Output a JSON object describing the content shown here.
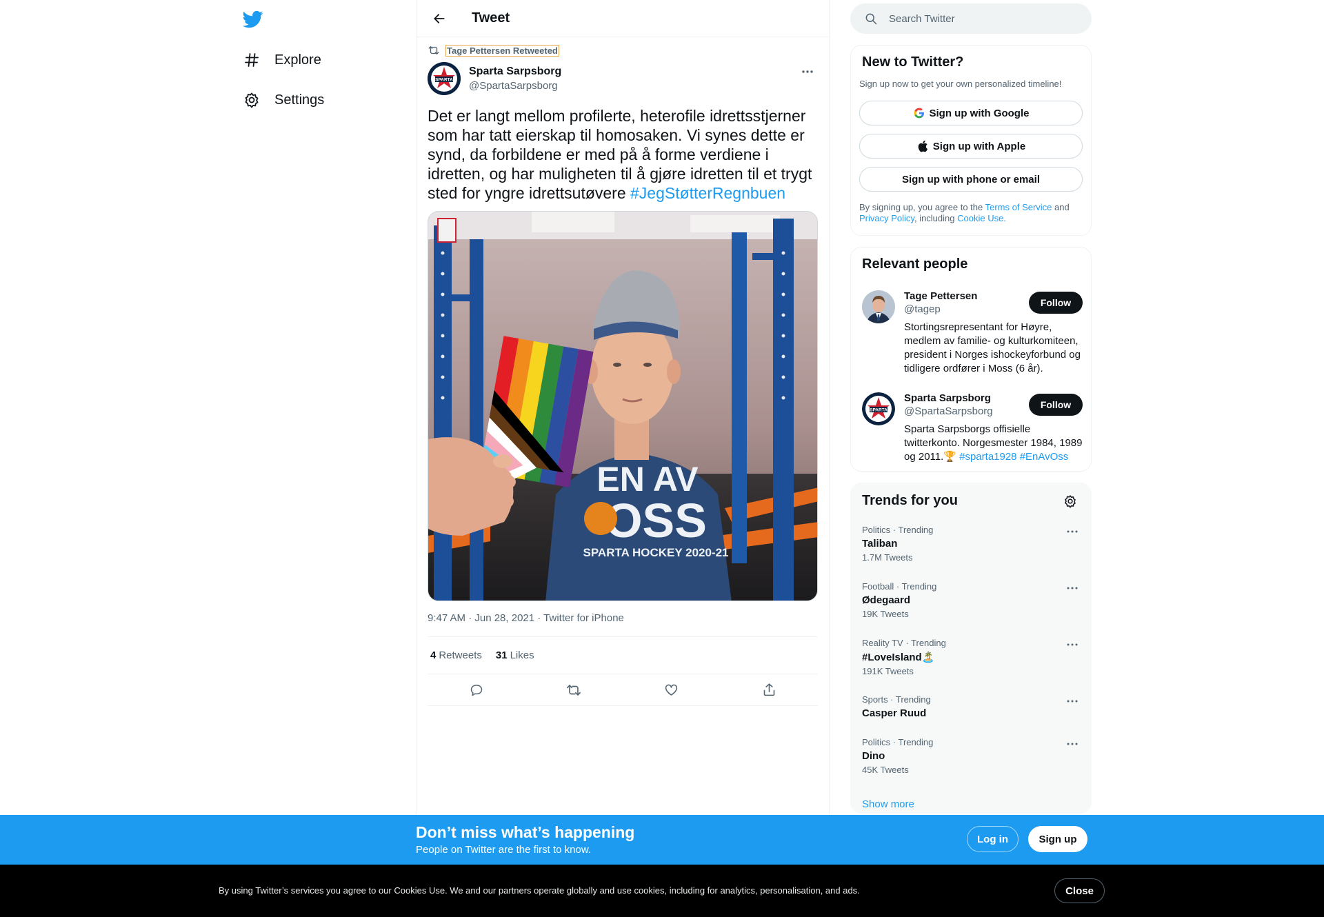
{
  "nav": {
    "logo_icon": "twitter-bird-icon",
    "items": [
      {
        "label": "Explore",
        "icon": "hashtag-icon"
      },
      {
        "label": "Settings",
        "icon": "gear-icon"
      }
    ]
  },
  "header": {
    "title": "Tweet"
  },
  "tweet": {
    "retweeted_by": "Tage Pettersen Retweeted",
    "author_name": "Sparta Sarpsborg",
    "author_handle": "@SpartaSarpsborg",
    "text": "Det er langt mellom profilerte, heterofile idrettsstjerner som har tatt eierskap til homosaken. Vi synes dette er synd, da forbildene er med på å forme verdiene i idretten, og har muligheten til å gjøre idretten til et trygt sted for yngre idrettsutøvere ",
    "hashtag": "#JegStøtterRegnbuen",
    "shirt_line1": "EN AV",
    "shirt_line2": "OSS",
    "shirt_line3": "SPARTA HOCKEY 2020-21",
    "meta": "9:47 AM · Jun 28, 2021 · Twitter for iPhone",
    "retweets_count": "4",
    "retweets_label": "Retweets",
    "likes_count": "31",
    "likes_label": "Likes"
  },
  "search": {
    "placeholder": "Search Twitter"
  },
  "signup": {
    "title": "New to Twitter?",
    "subtitle": "Sign up now to get your own personalized timeline!",
    "google": "Sign up with Google",
    "apple": "Sign up with Apple",
    "phone_email": "Sign up with phone or email",
    "legal_prefix": "By signing up, you agree to the ",
    "terms": "Terms of Service",
    "and": " and ",
    "privacy": "Privacy Policy",
    "including": ", including ",
    "cookie_use": "Cookie Use."
  },
  "relevant_people": {
    "title": "Relevant people",
    "follow_label": "Follow",
    "people": [
      {
        "name": "Tage Pettersen",
        "handle": "@tagep",
        "bio": "Stortingsrepresentant for Høyre, medlem av familie- og kulturkomiteen, president i Norges ishockeyforbund og tidligere ordfører i Moss (6 år)."
      },
      {
        "name": "Sparta Sarpsborg",
        "handle": "@SpartaSarpsborg",
        "bio": "Sparta Sarpsborgs offisielle twitterkonto. Norgesmester 1984, 1989 og 2011.🏆 ",
        "tag1": "#sparta1928",
        "tag2": "#EnAvOss"
      }
    ]
  },
  "trends": {
    "title": "Trends for you",
    "items": [
      {
        "context": "Politics · Trending",
        "name": "Taliban",
        "count": "1.7M Tweets"
      },
      {
        "context": "Football · Trending",
        "name": "Ødegaard",
        "count": "19K Tweets"
      },
      {
        "context": "Reality TV · Trending",
        "name": "#LoveIsland🏝️",
        "count": "191K Tweets"
      },
      {
        "context": "Sports · Trending",
        "name": "Casper Ruud",
        "count": ""
      },
      {
        "context": "Politics · Trending",
        "name": "Dino",
        "count": "45K Tweets"
      }
    ],
    "show_more": "Show more"
  },
  "bottom_bar": {
    "title": "Don’t miss what’s happening",
    "subtitle": "People on Twitter are the first to know.",
    "login": "Log in",
    "signup": "Sign up"
  },
  "cookie": {
    "text_prefix": "By using Twitter’s services you agree to our ",
    "cookies_use": "Cookies Use",
    "text_suffix": ". We and our partners operate globally and use cookies, including for analytics, personalisation, and ads.",
    "close": "Close"
  },
  "colors": {
    "accent": "#1d9bf0",
    "text": "#0f1419",
    "muted": "#536471",
    "border": "#eff3f4"
  }
}
